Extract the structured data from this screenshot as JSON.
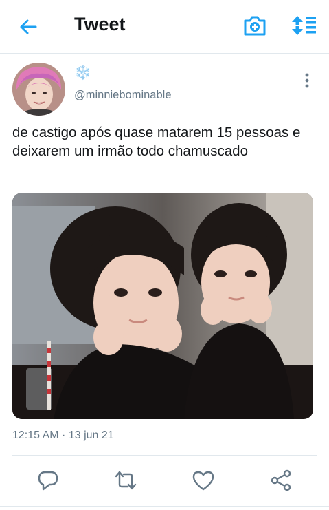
{
  "header": {
    "title": "Tweet"
  },
  "tweet": {
    "display_name": "❄️",
    "handle": "@minniebominable",
    "text": "de castigo após quase matarem 15 pessoas e deixarem um irmão todo chamuscado",
    "timestamp": "12:15 AM · 13 jun 21"
  },
  "icons": {
    "back": "back-arrow-icon",
    "camera": "camera-plus-icon",
    "sort": "sort-icon",
    "more": "more-vertical-icon",
    "reply": "reply-icon",
    "retweet": "retweet-icon",
    "like": "like-icon",
    "share": "share-icon"
  },
  "colors": {
    "accent": "#1da1f2",
    "secondary_text": "#657786",
    "divider": "#e1e8ed"
  }
}
